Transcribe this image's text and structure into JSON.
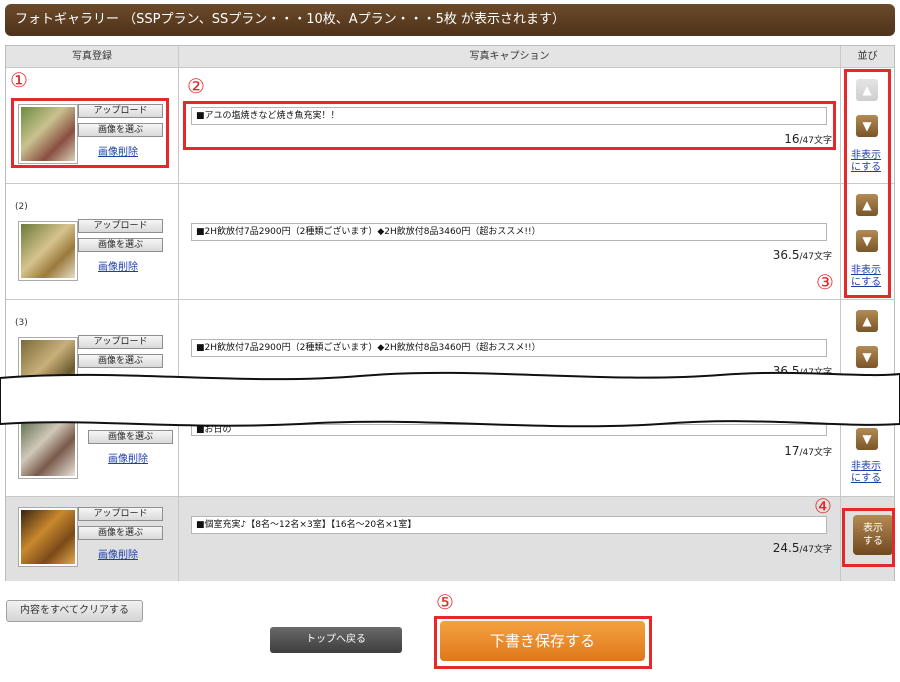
{
  "header": {
    "title": "フォトギャラリー （SSPプラン、SSプラン・・・10枚、Aプラン・・・5枚 が表示されます）"
  },
  "table": {
    "columns": [
      "写真登録",
      "写真キャプション",
      "並び"
    ],
    "buttons": {
      "upload": "アップロード",
      "choose": "画像を選ぶ",
      "delete": "画像削除"
    },
    "count_unit": "/47文字",
    "hide_label_1": "非表示",
    "hide_label_2": "にする",
    "show_label_1": "表示",
    "show_label_2": "する",
    "up_icon": "arrow-up-icon",
    "down_icon": "arrow-down-icon",
    "rows": [
      {
        "num": "",
        "caption": "■アユの塩焼きなど焼き魚充実！！",
        "count": "16"
      },
      {
        "num": "(2)",
        "caption": "■2H飲放付7品2900円（2種類ございます）◆2H飲放付8品3460円（超おススメ!!）",
        "count": "36.5"
      },
      {
        "num": "(3)",
        "caption": "■2H飲放付7品2900円（2種類ございます）◆2H飲放付8品3460円（超おススメ!!）",
        "count": "36.5"
      },
      {
        "num": "",
        "caption": "■お日の",
        "count": "17"
      },
      {
        "num": "",
        "caption": "■個室充実♪【8名～12名×3室】【16名～20名×1室】",
        "count": "24.5"
      }
    ]
  },
  "annotations": [
    "①",
    "②",
    "③",
    "④",
    "⑤"
  ],
  "footer": {
    "clear": "内容をすべてクリアする",
    "top": "トップへ戻る",
    "save": "下書き保存する"
  },
  "colors": {
    "accent_red": "#e32929",
    "header_brown": "#5b3d20",
    "arrow_brown": "#8a6230",
    "save_orange": "#ea8a2a"
  }
}
